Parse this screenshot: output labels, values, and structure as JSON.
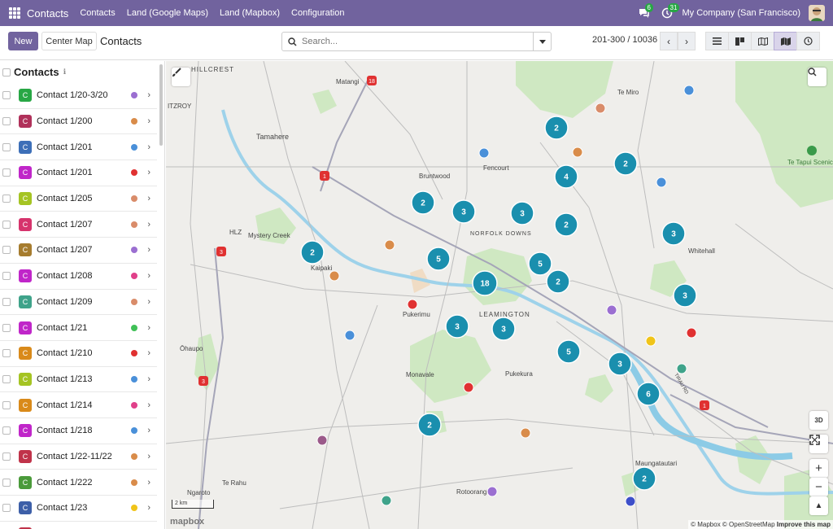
{
  "topnav": {
    "app_name": "Contacts",
    "menu": [
      "Contacts",
      "Land (Google Maps)",
      "Land (Mapbox)",
      "Configuration"
    ],
    "messages_count": "6",
    "activities_count": "31",
    "company": "My Company (San Francisco)"
  },
  "controlbar": {
    "new_label": "New",
    "center_label": "Center Map",
    "breadcrumb": "Contacts",
    "search_placeholder": "Search...",
    "pager": "201-300 / 10036",
    "prev": "‹",
    "next": "›"
  },
  "panel": {
    "title": "Contacts",
    "info": "ℹ",
    "items": [
      {
        "initial": "C",
        "label": "Contact 1/20-3/20",
        "tag_color": "#28a745",
        "dot_color": "#9b6fd1"
      },
      {
        "initial": "C",
        "label": "Contact 1/200",
        "tag_color": "#b0315a",
        "dot_color": "#d98c4a"
      },
      {
        "initial": "C",
        "label": "Contact 1/201",
        "tag_color": "#3d6fb8",
        "dot_color": "#4a90d9"
      },
      {
        "initial": "C",
        "label": "Contact 1/201",
        "tag_color": "#c026c9",
        "dot_color": "#e03131"
      },
      {
        "initial": "C",
        "label": "Contact 1/205",
        "tag_color": "#a5c423",
        "dot_color": "#d98c6a"
      },
      {
        "initial": "C",
        "label": "Contact 1/207",
        "tag_color": "#d6336c",
        "dot_color": "#d98c6a"
      },
      {
        "initial": "C",
        "label": "Contact 1/207",
        "tag_color": "#a67c2e",
        "dot_color": "#9b6fd1"
      },
      {
        "initial": "C",
        "label": "Contact 1/208",
        "tag_color": "#c026c9",
        "dot_color": "#e0408a"
      },
      {
        "initial": "C",
        "label": "Contact 1/209",
        "tag_color": "#3fa38a",
        "dot_color": "#d98c6a"
      },
      {
        "initial": "C",
        "label": "Contact 1/21",
        "tag_color": "#c026c9",
        "dot_color": "#40c057"
      },
      {
        "initial": "C",
        "label": "Contact 1/210",
        "tag_color": "#d98a1a",
        "dot_color": "#e03131"
      },
      {
        "initial": "C",
        "label": "Contact 1/213",
        "tag_color": "#a5c423",
        "dot_color": "#4a90d9"
      },
      {
        "initial": "C",
        "label": "Contact 1/214",
        "tag_color": "#d98a1a",
        "dot_color": "#e0408a"
      },
      {
        "initial": "C",
        "label": "Contact 1/218",
        "tag_color": "#c026c9",
        "dot_color": "#4a90d9"
      },
      {
        "initial": "C",
        "label": "Contact 1/22-11/22",
        "tag_color": "#c0334a",
        "dot_color": "#d98c4a"
      },
      {
        "initial": "C",
        "label": "Contact 1/222",
        "tag_color": "#4a9a3a",
        "dot_color": "#d98c4a"
      },
      {
        "initial": "C",
        "label": "Contact 1/23",
        "tag_color": "#3d5fa8",
        "dot_color": "#f0c419"
      },
      {
        "initial": "C",
        "label": "",
        "tag_color": "#c0334a",
        "dot_color": "#e03131"
      }
    ]
  },
  "map": {
    "places": [
      {
        "name": "HILLCREST"
      },
      {
        "name": "Matangi"
      },
      {
        "name": "Te Miro"
      },
      {
        "name": "ITZROY"
      },
      {
        "name": "Tamahere"
      },
      {
        "name": "Fencourt"
      },
      {
        "name": "Bruntwood"
      },
      {
        "name": "Te Tapui Scenic Reserve"
      },
      {
        "name": "HLZ"
      },
      {
        "name": "Mystery Creek"
      },
      {
        "name": "NORFOLK DOWNS"
      },
      {
        "name": "Whitehall"
      },
      {
        "name": "Kaipaki"
      },
      {
        "name": "Pukerimu"
      },
      {
        "name": "LEAMINGTON"
      },
      {
        "name": "Ōhaupo"
      },
      {
        "name": "Monavale"
      },
      {
        "name": "Pukekura"
      },
      {
        "name": "TIRAU RD"
      },
      {
        "name": "Maungatautari"
      },
      {
        "name": "Te Rahu"
      },
      {
        "name": "Ngaroto"
      },
      {
        "name": "Rotoorangi"
      }
    ],
    "road_shields": [
      "18",
      "1",
      "3",
      "3",
      "1"
    ],
    "clusters": [
      "2",
      "2",
      "4",
      "2",
      "3",
      "3",
      "2",
      "3",
      "2",
      "5",
      "5",
      "2",
      "18",
      "3",
      "3",
      "5",
      "3",
      "6",
      "2",
      "2",
      "3"
    ],
    "scale_label": "2 km",
    "mapbox_logo": "mapbox",
    "attribution_a": "© Mapbox © OpenStreetMap ",
    "attribution_b": "Improve this map",
    "btn_3d": "3D",
    "zoom_in": "+",
    "zoom_out": "−",
    "compass": "▲"
  }
}
